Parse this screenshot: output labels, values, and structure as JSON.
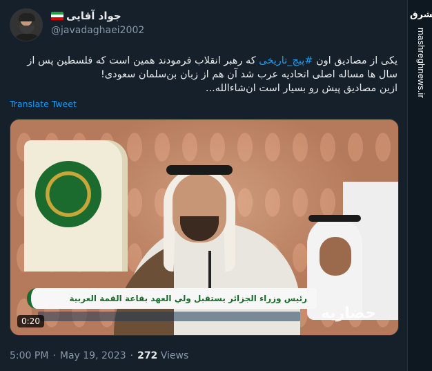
{
  "author": {
    "display_name": "جواد آقایی",
    "handle": "@javadaghaei2002",
    "flag": {
      "colors": [
        "#239f40",
        "#ffffff",
        "#da0000"
      ]
    }
  },
  "tweet": {
    "text_before_hashtag": "یکی از مصادیق اون ",
    "hashtag": "#پیچ_تاریخی",
    "text_after_hashtag": " که رهبر انقلاب فرمودند همین است که فلسطین پس از سال ها مساله اصلی اتحادیه عرب شد آن هم از زبان بن‌سلمان سعودی!",
    "line_3": "ازین مصادیق پیش رو بسیار است ان‌شاءالله...",
    "translate_label": "Translate Tweet"
  },
  "media": {
    "duration": "0:20",
    "caption": "رئیس وزراء الجزائر يستقبل ولي العهد بقاعة القمة العربية",
    "watermark": "حضاریه"
  },
  "meta": {
    "time": "5:00 PM",
    "separator": "·",
    "date": "May 19, 2023",
    "separator2": "·",
    "views_count": "272",
    "views_label": "Views"
  },
  "side": {
    "logo": "مشرق",
    "url": "mashreghnews.ir"
  },
  "colors": {
    "background": "#15202b",
    "link": "#1d9bf0",
    "muted": "#8b98a5"
  }
}
